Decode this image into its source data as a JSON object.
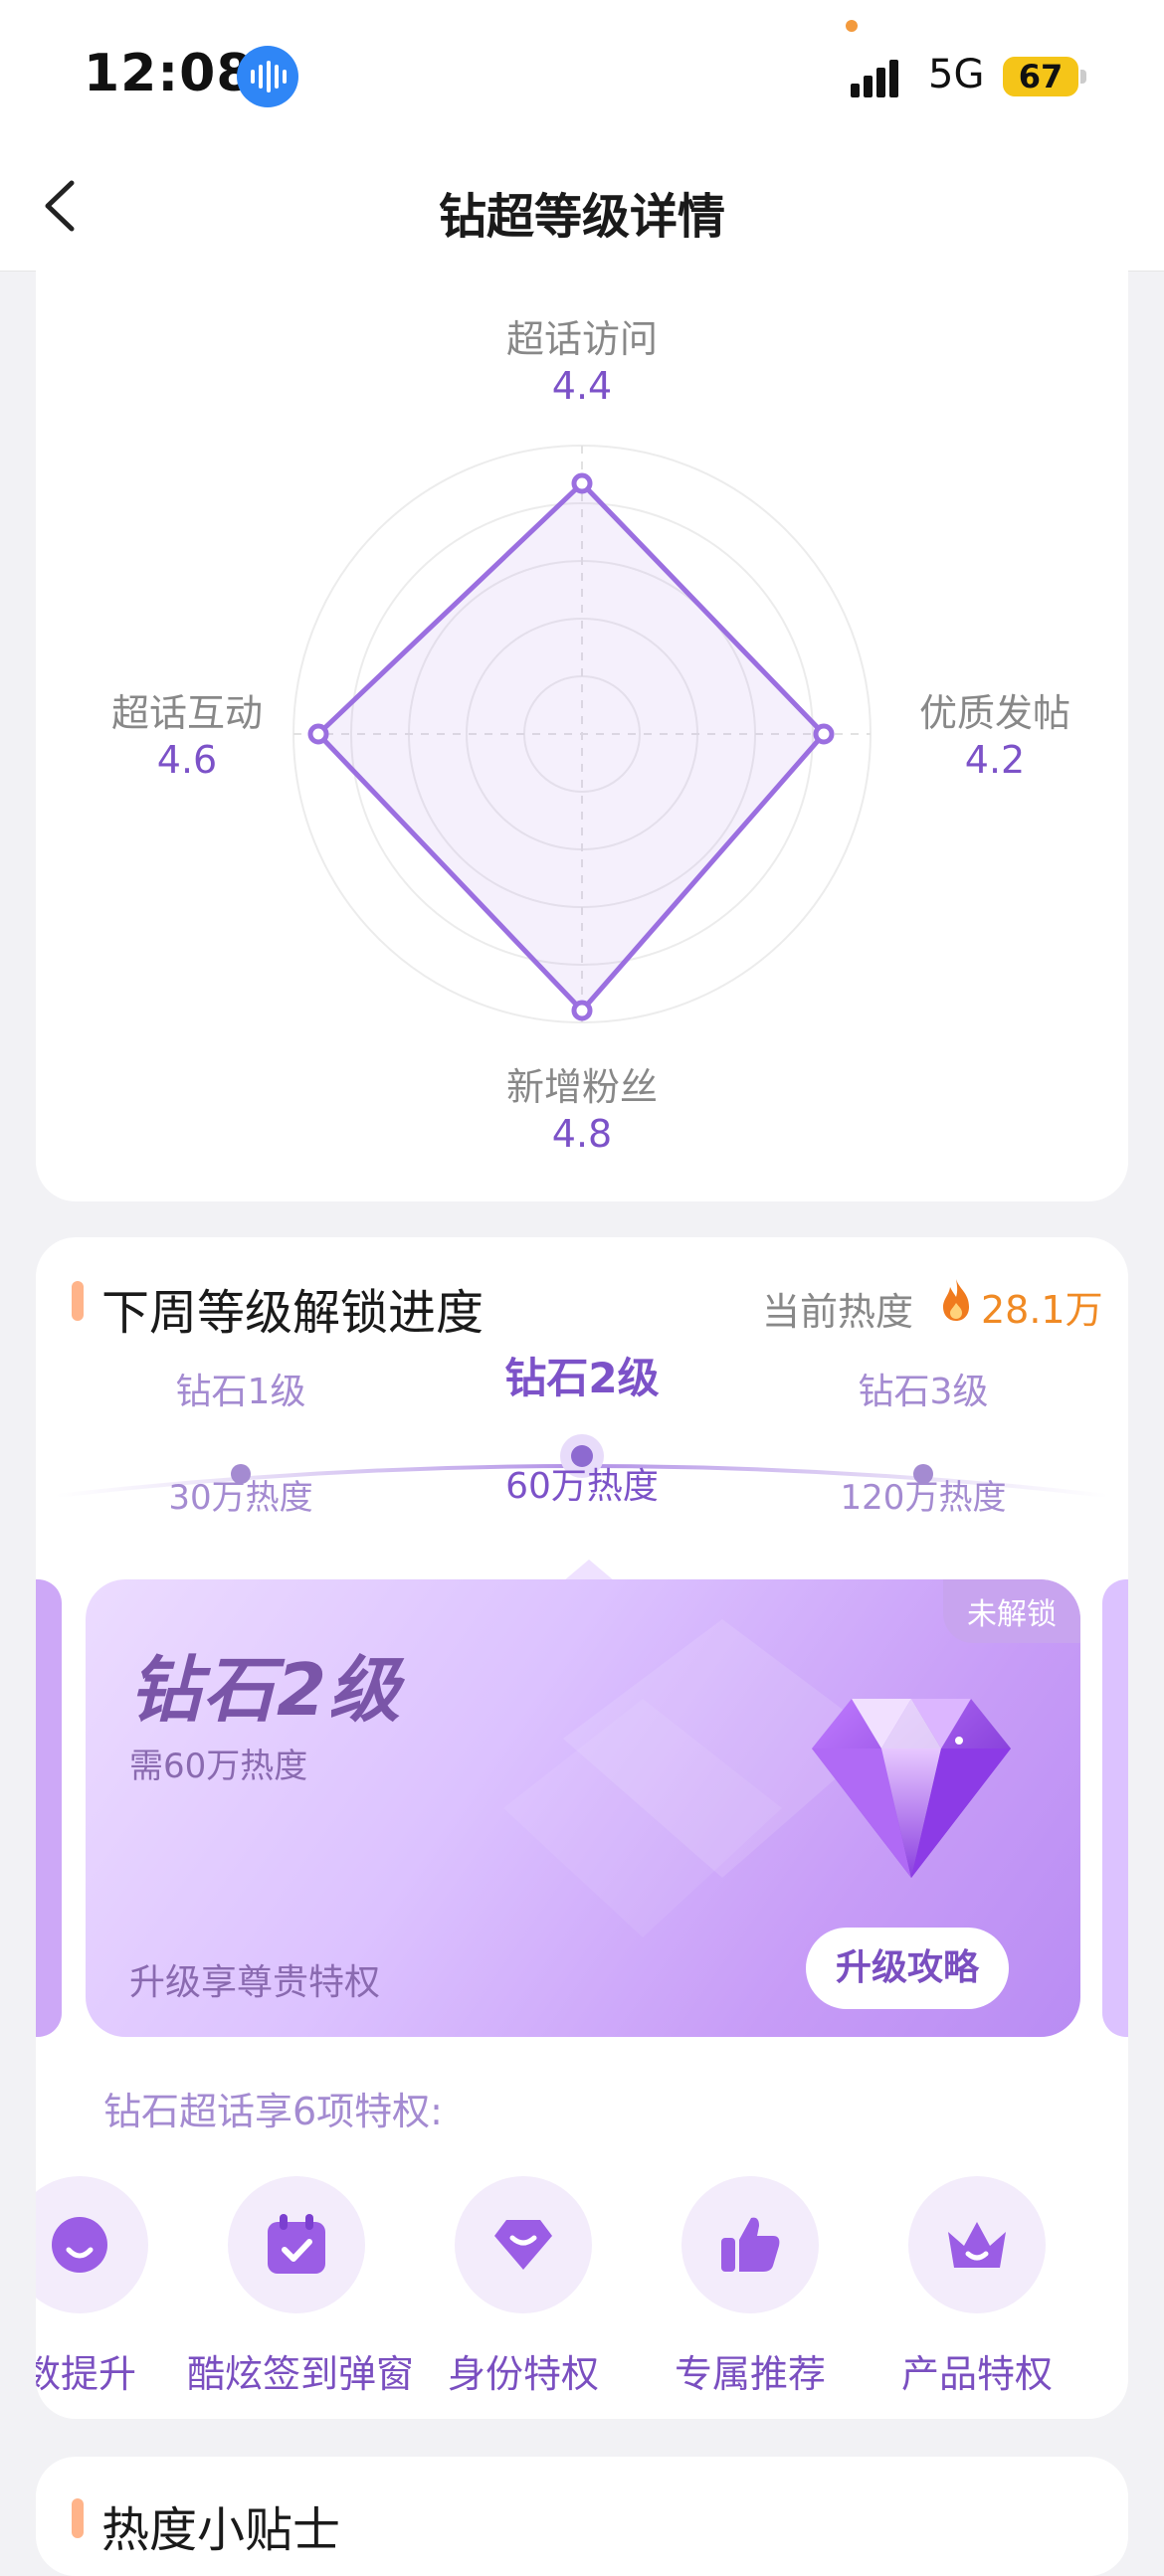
{
  "status": {
    "time": "12:08",
    "network": "5G",
    "battery": "67"
  },
  "nav": {
    "title": "钻超等级详情"
  },
  "radar": {
    "top": {
      "label": "超话访问",
      "value": "4.4"
    },
    "right": {
      "label": "优质发帖",
      "value": "4.2"
    },
    "bottom": {
      "label": "新增粉丝",
      "value": "4.8"
    },
    "left": {
      "label": "超话互动",
      "value": "4.6"
    },
    "color": "#9b6fe0"
  },
  "progress": {
    "title": "下周等级解锁进度",
    "heat_label": "当前热度",
    "heat_value": "28.1万",
    "levels": [
      {
        "name": "钻石1级",
        "heat": "30万热度"
      },
      {
        "name": "钻石2级",
        "heat": "60万热度"
      },
      {
        "name": "钻石3级",
        "heat": "120万热度"
      }
    ],
    "card": {
      "name": "钻石2级",
      "need": "需60万热度",
      "badge": "未解锁",
      "footer": "升级享尊贵特权",
      "button": "升级攻略"
    },
    "privileges_title": "钻石超话享6项特权:",
    "privileges": [
      {
        "label": "数提升",
        "icon": "smile-icon"
      },
      {
        "label": "酷炫签到弹窗",
        "icon": "calendar-check-icon"
      },
      {
        "label": "身份特权",
        "icon": "gem-icon"
      },
      {
        "label": "专属推荐",
        "icon": "thumbs-up-icon"
      },
      {
        "label": "产品特权",
        "icon": "crown-icon"
      }
    ]
  },
  "tips": {
    "title": "热度小贴士"
  },
  "colors": {
    "accent": "#7c52c8",
    "heat": "#f08a24"
  }
}
